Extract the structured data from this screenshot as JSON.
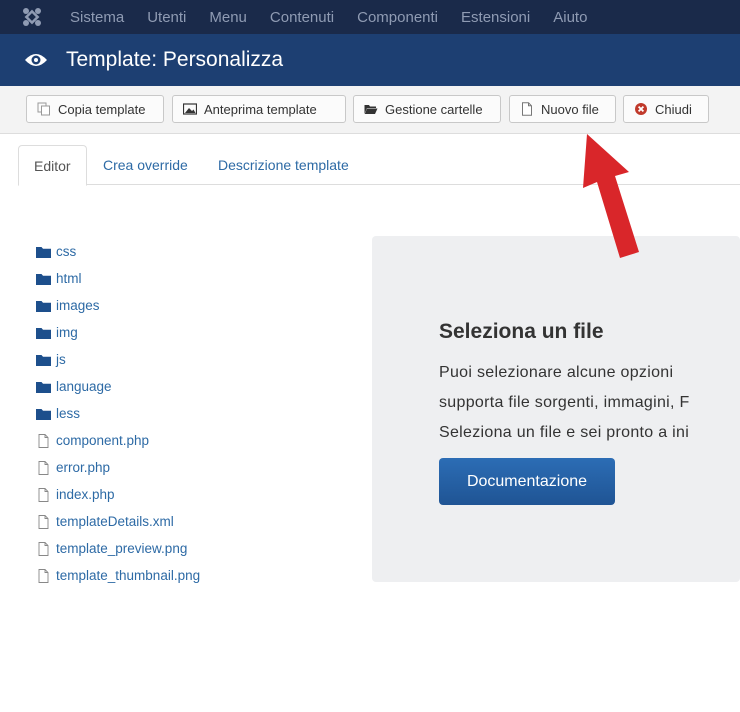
{
  "topbar": {
    "logo_icon": "joomla-logo-icon",
    "menu": [
      "Sistema",
      "Utenti",
      "Menu",
      "Contenuti",
      "Componenti",
      "Estensioni",
      "Aiuto"
    ]
  },
  "titlebar": {
    "icon": "eye-icon",
    "title": "Template: Personalizza"
  },
  "toolbar": {
    "copy_label": "Copia template",
    "preview_label": "Anteprima template",
    "folders_label": "Gestione cartelle",
    "newfile_label": "Nuovo file",
    "close_label": "Chiudi"
  },
  "tabs": {
    "editor": "Editor",
    "override": "Crea override",
    "description": "Descrizione template"
  },
  "tree": {
    "folders": [
      "css",
      "html",
      "images",
      "img",
      "js",
      "language",
      "less"
    ],
    "files": [
      "component.php",
      "error.php",
      "index.php",
      "templateDetails.xml",
      "template_preview.png",
      "template_thumbnail.png"
    ]
  },
  "panel": {
    "heading": "Seleziona un file",
    "line1": "Puoi selezionare alcune opzioni",
    "line2": "supporta file sorgenti, immagini, F",
    "line3": "Seleziona un file e sei pronto a ini",
    "button": "Documentazione"
  },
  "colors": {
    "topbar": "#1a2a4a",
    "titlebar": "#1d3f72",
    "link": "#2d6aa5",
    "button": "#2c6db5",
    "arrow": "#d9262a"
  }
}
